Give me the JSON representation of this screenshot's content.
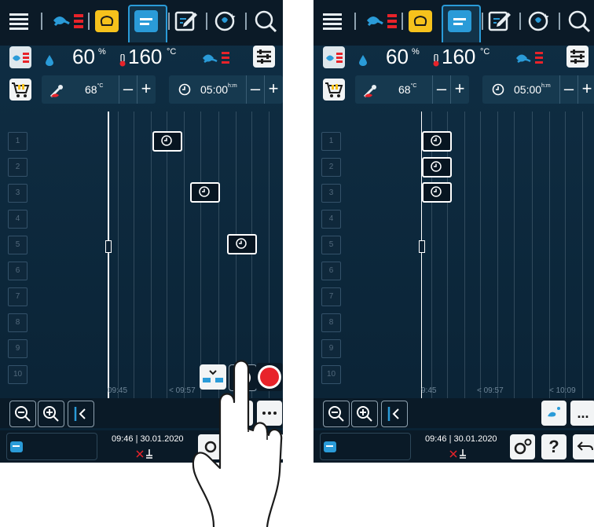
{
  "colors": {
    "accent": "#2a9bd8",
    "record": "#e8232a",
    "background": "#0f2e44",
    "bar": "#0b1a27"
  },
  "left": {
    "humidity": {
      "value": "60",
      "unit": "%"
    },
    "temperature": {
      "value": "160",
      "unit": "°C"
    },
    "core_temp": {
      "value": "68",
      "unit": "°C"
    },
    "timer": {
      "value": "05:00",
      "unit": "h:m"
    },
    "minus": "–",
    "plus": "+",
    "racks": [
      "1",
      "2",
      "3",
      "4",
      "5",
      "6",
      "7",
      "8",
      "9",
      "10"
    ],
    "timeline_labels": [
      "09:45",
      "< 09:57",
      ""
    ],
    "date": "09:46 | 30.01.2020"
  },
  "right": {
    "humidity": {
      "value": "60",
      "unit": "%"
    },
    "temperature": {
      "value": "160",
      "unit": "°C"
    },
    "core_temp": {
      "value": "68",
      "unit": "°C"
    },
    "timer": {
      "value": "05:00",
      "unit": "h:m"
    },
    "minus": "–",
    "plus": "+",
    "racks": [
      "1",
      "2",
      "3",
      "4",
      "5",
      "6",
      "7",
      "8",
      "9",
      "10"
    ],
    "timeline_labels": [
      "9:45",
      "< 09:57",
      "< 10:09"
    ],
    "date": "09:46 | 30.01.2020",
    "help": "?",
    "more": "..."
  },
  "icons": [
    "menu-icon",
    "cooking-paths-icon",
    "intelligent-cooking-icon",
    "production-manager-icon",
    "edit-icon",
    "favourites-icon",
    "search-icon",
    "hybrid-mode-icon",
    "humidity-icon",
    "thermometer-icon",
    "filter-icon",
    "basket-icon",
    "core-probe-icon",
    "clock-icon",
    "zoom-out-icon",
    "zoom-in-icon",
    "collapse-left-icon",
    "optimise-icon",
    "timer-icon",
    "record-icon",
    "cleaning-icon",
    "more-icon",
    "settings-icon",
    "help-icon",
    "back-icon",
    "tap-hand-icon"
  ]
}
